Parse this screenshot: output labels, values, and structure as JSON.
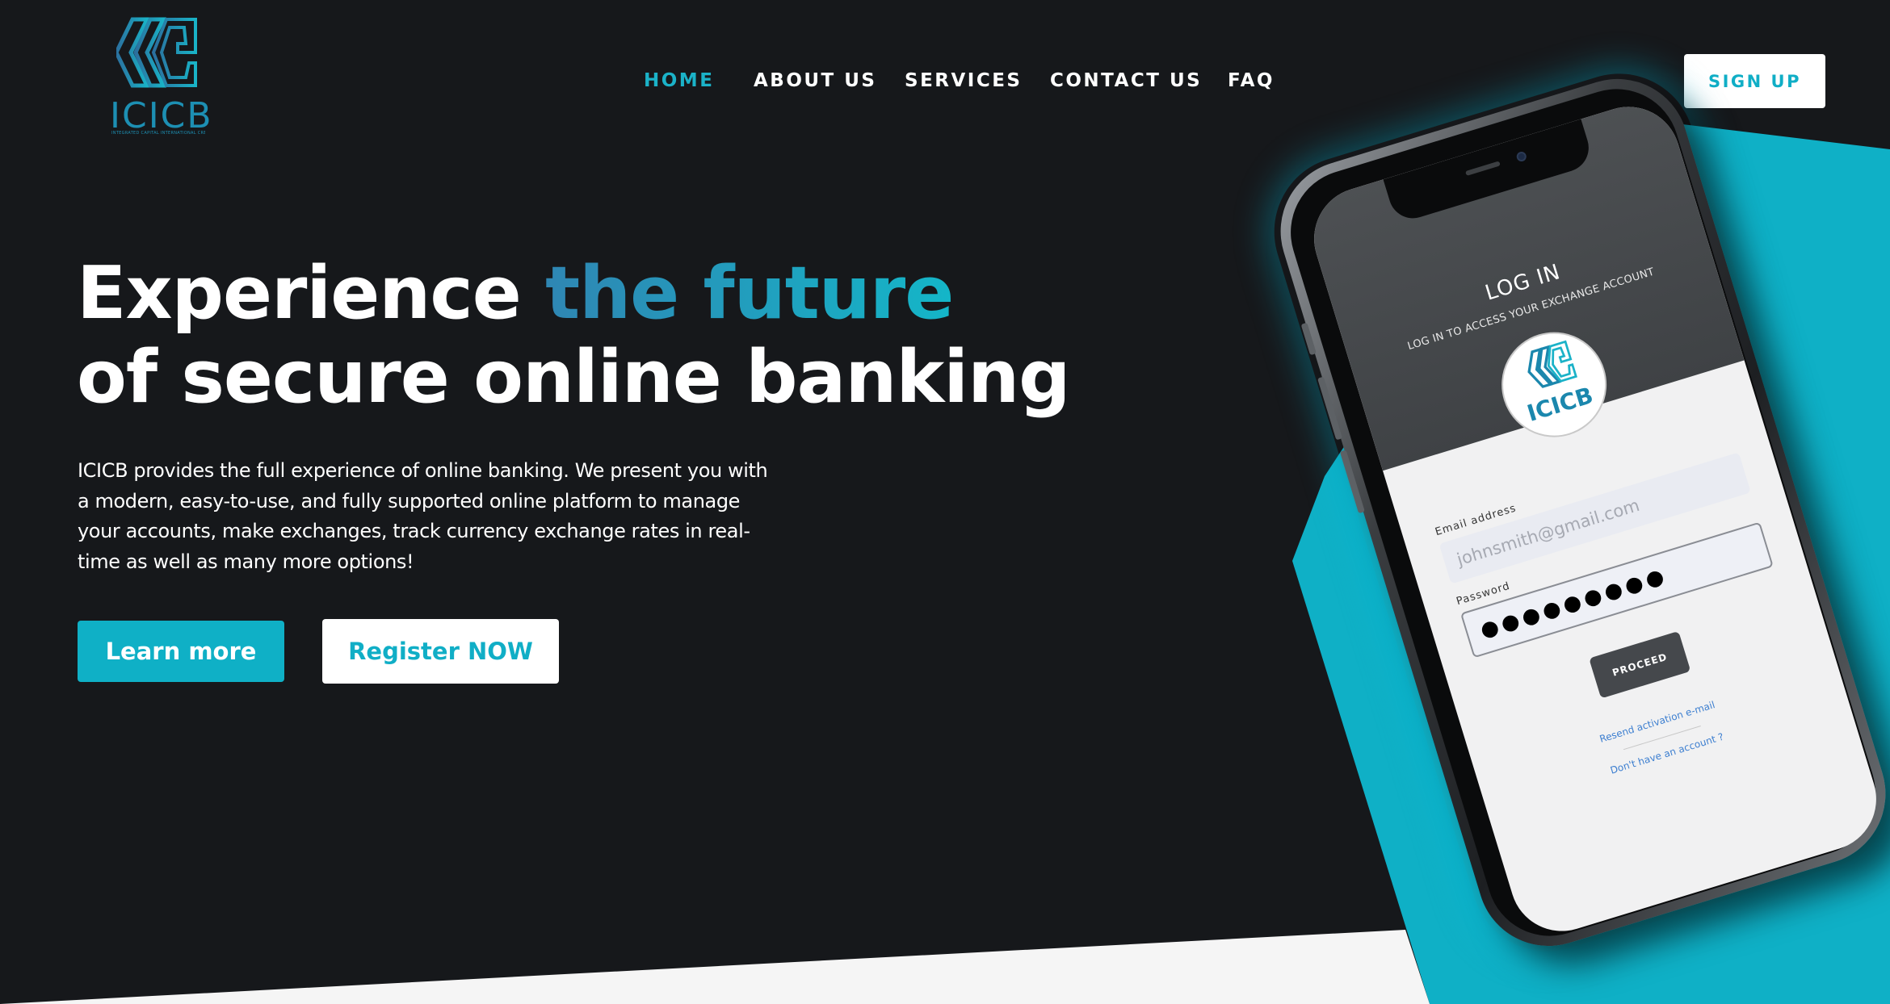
{
  "brand": {
    "name": "ICICB",
    "tagline": "INTEGRATED CAPITAL INTERNATIONAL CREDIT BANKING",
    "accent_color": "#10aec6",
    "background_color": "#16181b",
    "icon": "icicb-logo-icon"
  },
  "nav": {
    "items": [
      {
        "label": "HOME",
        "active": true
      },
      {
        "label": "ABOUT US",
        "active": false
      },
      {
        "label": "SERVICES",
        "active": false
      },
      {
        "label": "CONTACT US",
        "active": false
      },
      {
        "label": "FAQ",
        "active": false
      }
    ],
    "signup_label": "SIGN UP"
  },
  "hero": {
    "title_plain": "Experience ",
    "title_accent": "the future",
    "title_line2": "of secure online banking",
    "description": "ICICB provides the full experience of online banking. We present you with a modern, easy-to-use, and fully supported online platform to manage your accounts, make exchanges, track currency exchange rates in real-time as well as many more options!",
    "learn_more_label": "Learn more",
    "register_label": "Register NOW"
  },
  "phone_screen": {
    "title": "LOG IN",
    "subtitle": "LOG IN TO ACCESS YOUR EXCHANGE ACCOUNT",
    "logo_text": "ICICB",
    "email_label": "Email address",
    "email_placeholder": "johnsmith@gmail.com",
    "password_label": "Password",
    "password_value": "●●●●●●●●●",
    "proceed_label": "PROCEED",
    "resend_link": "Resend activation e-mail",
    "no_account_link": "Don't have an account ?"
  }
}
